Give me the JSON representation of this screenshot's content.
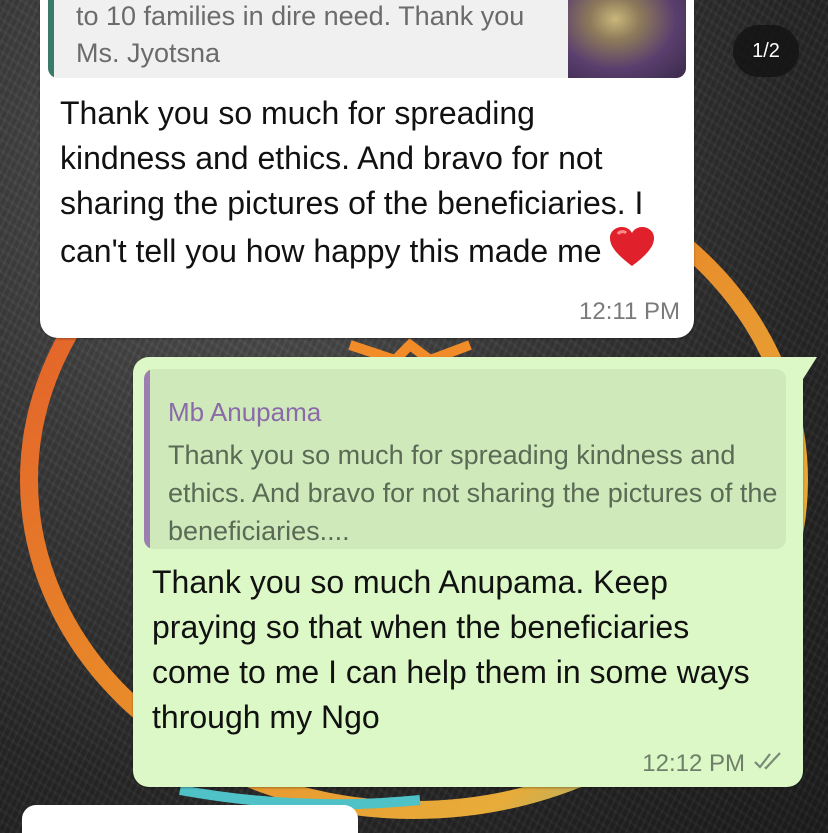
{
  "page_indicator": "1/2",
  "incoming": {
    "quoted_text": "to 10 families in dire need. Thank you Ms. Jyotsna",
    "message": "Thank you so much for spreading kindness and ethics. And bravo for not sharing the pictures of the beneficiaries. I can't tell you how happy this made me",
    "emoji": "red-heart",
    "time": "12:11 PM"
  },
  "outgoing": {
    "quoted_author": "Mb Anupama",
    "quoted_text": "Thank you so much for spreading kindness and ethics. And bravo for not sharing the pictures of the beneficiaries....",
    "message": "Thank you so much Anupama. Keep praying so that when the beneficiaries come to me I can help them in some ways through my Ngo",
    "time": "12:12 PM",
    "status_icon": "double-check-read"
  },
  "colors": {
    "incoming_bubble": "#ffffff",
    "outgoing_bubble": "#dcf8c6",
    "quote_author": "#8a6aa8"
  }
}
